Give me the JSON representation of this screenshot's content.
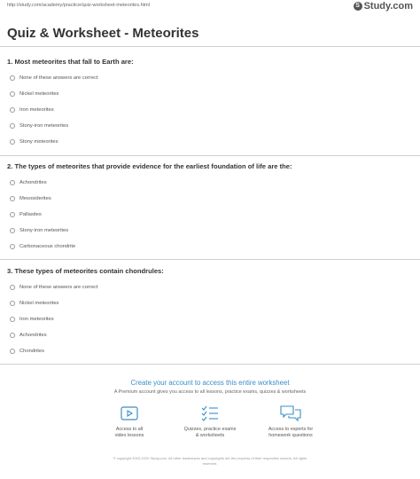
{
  "header": {
    "url": "http://study.com/academy/practice/quiz-worksheet-meteorites.html",
    "logo_text": "Study.com",
    "logo_mark": "S"
  },
  "page": {
    "title": "Quiz & Worksheet - Meteorites"
  },
  "questions": [
    {
      "text": "1. Most meteorites that fall to Earth are:",
      "options": [
        "None of these answers are correct",
        "Nickel meteorites",
        "Iron meteorites",
        "Stony-iron meteorites",
        "Stony meteorites"
      ]
    },
    {
      "text": "2. The types of meteorites that provide evidence for the earliest foundation of life are the:",
      "options": [
        "Achondrites",
        "Mesosiderites",
        "Pallasites",
        "Stony-iron meteorites",
        "Carbonaceous chondrite"
      ]
    },
    {
      "text": "3. These types of meteorites contain chondrules:",
      "options": [
        "None of these answers are correct",
        "Nickel meteorites",
        "Iron meteorites",
        "Achondrites",
        "Chondrites"
      ]
    }
  ],
  "cta": {
    "heading": "Create your account to access this entire worksheet",
    "subheading": "A Premium account gives you access to all lessons, practice exams, quizzes & worksheets",
    "features": [
      {
        "icon": "video-icon",
        "line1": "Access to all",
        "line2": "video lessons"
      },
      {
        "icon": "checklist-icon",
        "line1": "Quizzes, practice exams",
        "line2": "& worksheets"
      },
      {
        "icon": "chat-icon",
        "line1": "Access to experts for",
        "line2": "homework questions"
      }
    ],
    "copyright_line1": "© copyright 2003-2020 Study.com. All other trademarks and copyrights are the property of their respective owners. All rights",
    "copyright_line2": "reserved."
  },
  "colors": {
    "accent": "#3b8ec8",
    "text": "#333333",
    "muted": "#555555"
  }
}
